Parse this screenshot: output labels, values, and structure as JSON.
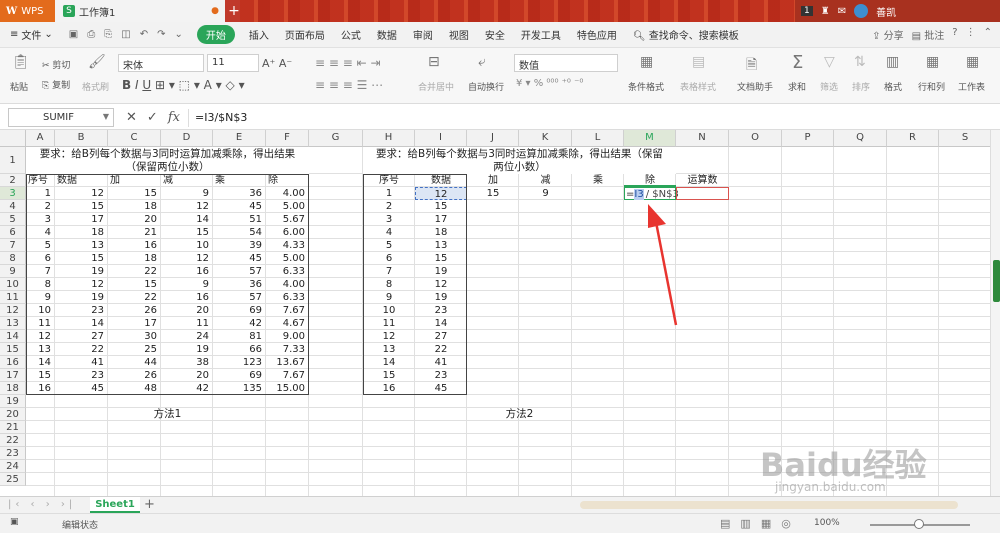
{
  "titlebar": {
    "app_name": "WPS",
    "doc_tab": "工作簿1",
    "notif_count": "1",
    "user": "善凯"
  },
  "menu": {
    "file": "文件",
    "items": [
      "开始",
      "插入",
      "页面布局",
      "公式",
      "数据",
      "审阅",
      "视图",
      "安全",
      "开发工具",
      "特色应用"
    ],
    "search": "查找命令、搜索模板",
    "share": "分享",
    "annotate": "批注",
    "help": "?"
  },
  "ribbon": {
    "paste": "粘贴",
    "cut": "剪切",
    "copy": "复制",
    "format_painter": "格式刷",
    "font_name": "宋体",
    "font_size": "11",
    "merge": "合并居中",
    "wrap": "自动换行",
    "number_format": "数值",
    "cond_format": "条件格式",
    "table_style": "表格样式",
    "doc_helper": "文档助手",
    "sum": "求和",
    "filter": "筛选",
    "sort": "排序",
    "format": "格式",
    "rowcol": "行和列",
    "worksheet": "工作表"
  },
  "formula_bar": {
    "name_box": "SUMIF",
    "formula": "=I3/$N$3"
  },
  "columns": [
    "A",
    "B",
    "C",
    "D",
    "E",
    "F",
    "G",
    "H",
    "I",
    "J",
    "K",
    "L",
    "M",
    "N",
    "O",
    "P",
    "Q",
    "R",
    "S"
  ],
  "rows": [
    "1",
    "2",
    "3",
    "4",
    "5",
    "6",
    "7",
    "8",
    "9",
    "10",
    "11",
    "12",
    "13",
    "14",
    "15",
    "16",
    "17",
    "18",
    "19",
    "20",
    "21",
    "22",
    "23",
    "24",
    "25"
  ],
  "left_table": {
    "title": "要求：给B列每个数据与3同时运算加减乘除，得出结果（保留两位小数）",
    "headers": [
      "序号",
      "数据",
      "加",
      "减",
      "乘",
      "除"
    ],
    "rows": [
      [
        "1",
        "12",
        "15",
        "9",
        "36",
        "4.00"
      ],
      [
        "2",
        "15",
        "18",
        "12",
        "45",
        "5.00"
      ],
      [
        "3",
        "17",
        "20",
        "14",
        "51",
        "5.67"
      ],
      [
        "4",
        "18",
        "21",
        "15",
        "54",
        "6.00"
      ],
      [
        "5",
        "13",
        "16",
        "10",
        "39",
        "4.33"
      ],
      [
        "6",
        "15",
        "18",
        "12",
        "45",
        "5.00"
      ],
      [
        "7",
        "19",
        "22",
        "16",
        "57",
        "6.33"
      ],
      [
        "8",
        "12",
        "15",
        "9",
        "36",
        "4.00"
      ],
      [
        "9",
        "19",
        "22",
        "16",
        "57",
        "6.33"
      ],
      [
        "10",
        "23",
        "26",
        "20",
        "69",
        "7.67"
      ],
      [
        "11",
        "14",
        "17",
        "11",
        "42",
        "4.67"
      ],
      [
        "12",
        "27",
        "30",
        "24",
        "81",
        "9.00"
      ],
      [
        "13",
        "22",
        "25",
        "19",
        "66",
        "7.33"
      ],
      [
        "14",
        "41",
        "44",
        "38",
        "123",
        "13.67"
      ],
      [
        "15",
        "23",
        "26",
        "20",
        "69",
        "7.67"
      ],
      [
        "16",
        "45",
        "48",
        "42",
        "135",
        "15.00"
      ]
    ],
    "method_label": "方法1"
  },
  "right_table": {
    "title": "要求：给B列每个数据与3同时运算加减乘除，得出结果（保留两位小数）",
    "headers": [
      "序号",
      "数据",
      "加",
      "减",
      "乘",
      "除",
      "运算数"
    ],
    "row3_extra": {
      "J": "15",
      "K": "9",
      "M_formula_eq": "=",
      "M_formula_ref": "I3",
      "M_formula_rest": "/ $N$3"
    },
    "rows": [
      [
        "1",
        "12"
      ],
      [
        "2",
        "15"
      ],
      [
        "3",
        "17"
      ],
      [
        "4",
        "18"
      ],
      [
        "5",
        "13"
      ],
      [
        "6",
        "15"
      ],
      [
        "7",
        "19"
      ],
      [
        "8",
        "12"
      ],
      [
        "9",
        "19"
      ],
      [
        "10",
        "23"
      ],
      [
        "11",
        "14"
      ],
      [
        "12",
        "27"
      ],
      [
        "13",
        "22"
      ],
      [
        "14",
        "41"
      ],
      [
        "15",
        "23"
      ],
      [
        "16",
        "45"
      ]
    ],
    "method_label": "方法2"
  },
  "sheet_tab": "Sheet1",
  "status": {
    "mode": "编辑状态",
    "zoom": "100%"
  },
  "watermark": {
    "main": "Baidu经验",
    "sub": "jingyan.baidu.com"
  },
  "colors": {
    "accent_green": "#2aa559",
    "title_red": "#c0392b",
    "arrow_red": "#e8342f",
    "selection_blue": "#4472c4"
  }
}
